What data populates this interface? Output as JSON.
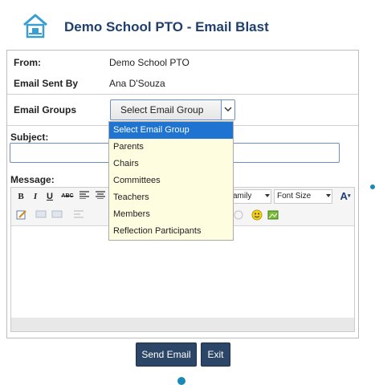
{
  "header": {
    "title": "Demo School PTO - Email Blast",
    "logo_icon": "school-house-icon"
  },
  "form": {
    "from_label": "From:",
    "from_value": "Demo School PTO",
    "sent_by_label": "Email Sent By",
    "sent_by_value": "Ana D'Souza",
    "groups_label": "Email Groups",
    "groups_selected": "Select Email Group",
    "subject_label": "Subject:",
    "subject_value": "",
    "message_label": "Message:"
  },
  "dropdown": {
    "options": [
      "Select Email Group",
      "Parents",
      "Chairs",
      "Committees",
      "Teachers",
      "Members",
      "Reflection Participants"
    ],
    "selected_index": 0,
    "highlight_color": "#1e74d0",
    "background": "#fffde0"
  },
  "editor": {
    "font_family_partial": "amily",
    "font_size_label": "Font Size",
    "bold": "B",
    "italic": "I",
    "underline": "U",
    "strike": "ABC",
    "font_color": "A"
  },
  "buttons": {
    "send": "Send Email",
    "exit": "Exit"
  },
  "colors": {
    "title": "#1f3f6e",
    "button": "#2c4668",
    "accent": "#1a89b8"
  }
}
